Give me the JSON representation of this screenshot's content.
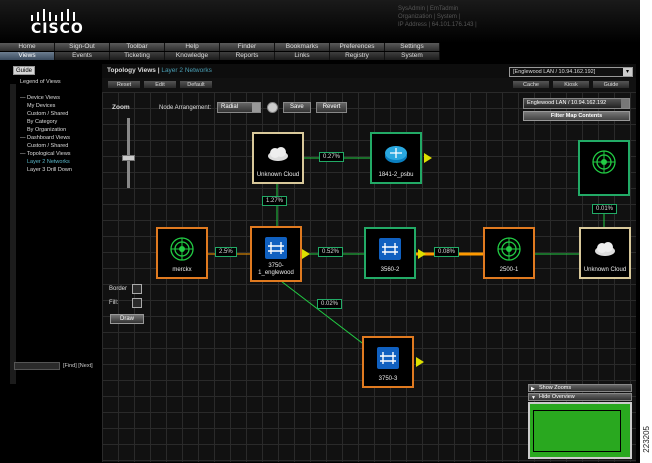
{
  "header": {
    "logo_text": "CISCO",
    "user_line1": "SysAdmin | EmTadmin",
    "user_line2": "Organization | System |",
    "user_line3": "IP Address | 64.101.176.143 |"
  },
  "menu_top": [
    "Home",
    "Sign-Out",
    "Toolbar",
    "Help",
    "Finder",
    "Bookmarks",
    "Preferences",
    "Settings"
  ],
  "menu_bottom": [
    "Views",
    "Events",
    "Ticketing",
    "Knowledge",
    "Reports",
    "Links",
    "Registry",
    "System"
  ],
  "left_panel": {
    "guide_tab": "Guide",
    "items": [
      {
        "label": "Legend of Views",
        "level": 0
      },
      {
        "label": "",
        "level": 0
      },
      {
        "label": "— Device Views",
        "level": 0
      },
      {
        "label": "My Devices",
        "level": 1
      },
      {
        "label": "Custom / Shared",
        "level": 1
      },
      {
        "label": "By Category",
        "level": 1
      },
      {
        "label": "By Organization",
        "level": 1
      },
      {
        "label": "— Dashboard Views",
        "level": 0
      },
      {
        "label": "Custom / Shared",
        "level": 1
      },
      {
        "label": "— Topological Views",
        "level": 0
      },
      {
        "label": "Layer 2 Networks",
        "level": 1,
        "selected": true
      },
      {
        "label": "Layer 3 Drill Down",
        "level": 1
      }
    ],
    "find_link": "[Find] [Next]"
  },
  "main": {
    "title": "Topology Views",
    "subtitle": "Layer 2 Networks",
    "device_select": "[Englewood LAN / 10.94.162.192]",
    "toolbar": {
      "reset": "Reset",
      "edit": "Edit",
      "default": "Default",
      "cache": "Cache",
      "kiosk": "Kiosk",
      "guide": "Guide"
    },
    "node_arrangement_label": "Node Arrangement:",
    "node_arrangement_value": "Radial",
    "save": "Save",
    "revert": "Revert",
    "zoom_label": "Zoom",
    "zoom_level": 0.45,
    "border_label": "Border",
    "fill_label": "Fill:",
    "draw": "Draw",
    "filter_select": "Englewood LAN / 10.94.162.192",
    "filter_button": "Filter Map Contents"
  },
  "nodes": {
    "unknown_cloud_top": "Unknown Cloud",
    "router_1841": "1841-2_psbu",
    "top_right": "",
    "merckx": "merckx",
    "sw3750_1": "3750-\n1_englewood",
    "sw3560": "3560-2",
    "n2500": "2500-1",
    "unknown_cloud_right": "Unknown Cloud",
    "sw3750_3": "3750-3"
  },
  "links": {
    "cloud_router": "0.27%",
    "cloud_3750": "1.27%",
    "merckx_3750": "2.5%",
    "sw3750_3560": "0.52%",
    "sw3560_2500": "0.08%",
    "top_right_cloud": "0.01%",
    "sw3750_3750_3": "0.02%"
  },
  "overview": {
    "show_zooms": "Show Zooms",
    "hide_overview": "Hide Overview"
  },
  "side_id": "223205",
  "colors": {
    "node_green": "#22aa66",
    "node_orange": "#e07a20",
    "node_tan": "#d8c89a",
    "link_green": "#22cc44",
    "link_orange": "#ff9a00",
    "arrow_yellow": "#dde000"
  }
}
